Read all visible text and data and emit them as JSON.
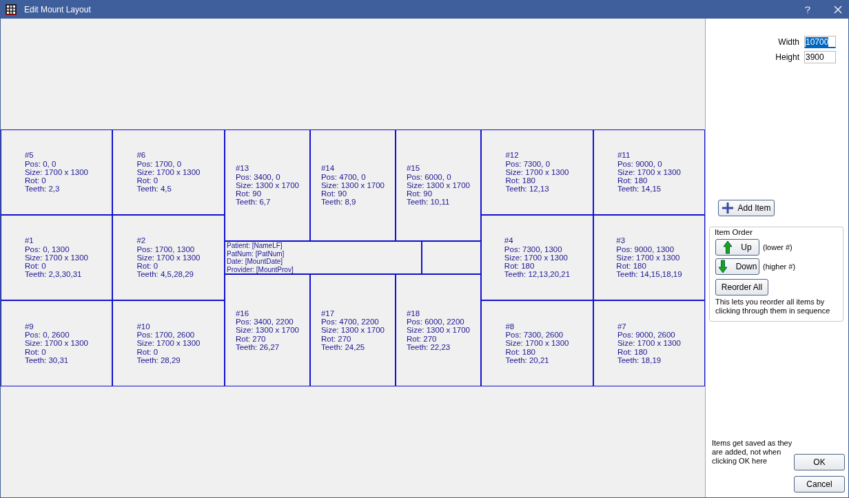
{
  "window": {
    "title": "Edit Mount Layout"
  },
  "mount": {
    "items": [
      {
        "kind": "image",
        "label": "#5",
        "pos": "Pos: 0, 0",
        "size": "Size: 1700 x 1300",
        "rot": "Rot: 0",
        "teeth": "Teeth: 2,3"
      },
      {
        "kind": "image",
        "label": "#6",
        "pos": "Pos: 1700, 0",
        "size": "Size: 1700 x 1300",
        "rot": "Rot: 0",
        "teeth": "Teeth: 4,5"
      },
      {
        "kind": "image",
        "label": "#13",
        "pos": "Pos: 3400, 0",
        "size": "Size: 1300 x 1700",
        "rot": "Rot: 90",
        "teeth": "Teeth: 6,7"
      },
      {
        "kind": "image",
        "label": "#14",
        "pos": "Pos: 4700, 0",
        "size": "Size: 1300 x 1700",
        "rot": "Rot: 90",
        "teeth": "Teeth: 8,9"
      },
      {
        "kind": "image",
        "label": "#15",
        "pos": "Pos: 6000, 0",
        "size": "Size: 1300 x 1700",
        "rot": "Rot: 90",
        "teeth": "Teeth: 10,11"
      },
      {
        "kind": "image",
        "label": "#12",
        "pos": "Pos: 7300, 0",
        "size": "Size: 1700 x 1300",
        "rot": "Rot: 180",
        "teeth": "Teeth: 12,13"
      },
      {
        "kind": "image",
        "label": "#11",
        "pos": "Pos: 9000, 0",
        "size": "Size: 1700 x 1300",
        "rot": "Rot: 180",
        "teeth": "Teeth: 14,15"
      },
      {
        "kind": "image",
        "label": "#1",
        "pos": "Pos: 0, 1300",
        "size": "Size: 1700 x 1300",
        "rot": "Rot: 0",
        "teeth": "Teeth: 2,3,30,31"
      },
      {
        "kind": "image",
        "label": "#2",
        "pos": "Pos: 1700, 1300",
        "size": "Size: 1700 x 1300",
        "rot": "Rot: 0",
        "teeth": "Teeth: 4,5,28,29"
      },
      {
        "kind": "text",
        "lines": [
          "Patient: [NameLF]",
          "PatNum: [PatNum]",
          "Date: [MountDate]",
          "Provider: [MountProv]"
        ]
      },
      {
        "kind": "image",
        "label": "#4",
        "pos": "Pos: 7300, 1300",
        "size": "Size: 1700 x 1300",
        "rot": "Rot: 180",
        "teeth": "Teeth: 12,13,20,21"
      },
      {
        "kind": "image",
        "label": "#3",
        "pos": "Pos: 9000, 1300",
        "size": "Size: 1700 x 1300",
        "rot": "Rot: 180",
        "teeth": "Teeth: 14,15,18,19"
      },
      {
        "kind": "image",
        "label": "#16",
        "pos": "Pos: 3400, 2200",
        "size": "Size: 1300 x 1700",
        "rot": "Rot: 270",
        "teeth": "Teeth: 26,27"
      },
      {
        "kind": "image",
        "label": "#17",
        "pos": "Pos: 4700, 2200",
        "size": "Size: 1300 x 1700",
        "rot": "Rot: 270",
        "teeth": "Teeth: 24,25"
      },
      {
        "kind": "image",
        "label": "#18",
        "pos": "Pos: 6000, 2200",
        "size": "Size: 1300 x 1700",
        "rot": "Rot: 270",
        "teeth": "Teeth: 22,23"
      },
      {
        "kind": "image",
        "label": "#9",
        "pos": "Pos: 0, 2600",
        "size": "Size: 1700 x 1300",
        "rot": "Rot: 0",
        "teeth": "Teeth: 30,31"
      },
      {
        "kind": "image",
        "label": "#10",
        "pos": "Pos: 1700, 2600",
        "size": "Size: 1700 x 1300",
        "rot": "Rot: 0",
        "teeth": "Teeth: 28,29"
      },
      {
        "kind": "image",
        "label": "#8",
        "pos": "Pos: 7300, 2600",
        "size": "Size: 1700 x 1300",
        "rot": "Rot: 180",
        "teeth": "Teeth: 20,21"
      },
      {
        "kind": "image",
        "label": "#7",
        "pos": "Pos: 9000, 2600",
        "size": "Size: 1700 x 1300",
        "rot": "Rot: 180",
        "teeth": "Teeth: 18,19"
      }
    ]
  },
  "fields": [
    {
      "label": "Width",
      "value": "10700",
      "focused": true
    },
    {
      "label": "Height",
      "value": "3900",
      "focused": false
    }
  ],
  "add_button": "Add Item",
  "item_order": {
    "title": "Item Order",
    "up_button": "Up",
    "up_hint": "(lower #)",
    "down_button": "Down",
    "down_hint": "(higher #)",
    "reorder_button": "Reorder All",
    "note": "This lets you reorder all items by clicking through them in sequence"
  },
  "save_note": "Items get saved as they are added, not when clicking OK here",
  "buttons": [
    "OK",
    "Cancel"
  ]
}
